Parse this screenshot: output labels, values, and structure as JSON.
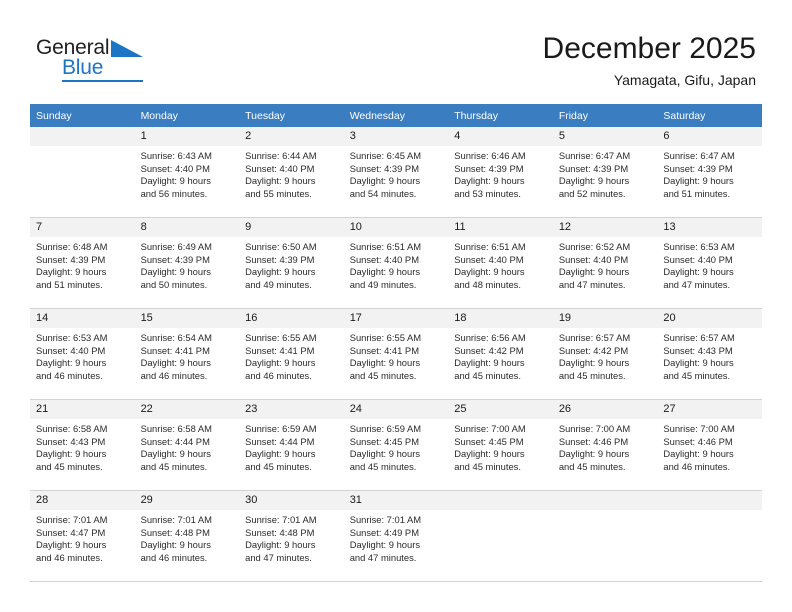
{
  "brand": {
    "name_part1": "General",
    "name_part2": "Blue",
    "triangle_icon": "triangle-icon",
    "accent_color": "#1c76c5"
  },
  "header": {
    "title": "December 2025",
    "subtitle": "Yamagata, Gifu, Japan"
  },
  "calendar": {
    "header_bg_color": "#3a7dc0",
    "daynum_bg_color": "#f2f2f2",
    "weekdays": [
      "Sunday",
      "Monday",
      "Tuesday",
      "Wednesday",
      "Thursday",
      "Friday",
      "Saturday"
    ],
    "weeks": [
      [
        {
          "day": "",
          "lines": []
        },
        {
          "day": "1",
          "lines": [
            "Sunrise: 6:43 AM",
            "Sunset: 4:40 PM",
            "Daylight: 9 hours",
            "and 56 minutes."
          ]
        },
        {
          "day": "2",
          "lines": [
            "Sunrise: 6:44 AM",
            "Sunset: 4:40 PM",
            "Daylight: 9 hours",
            "and 55 minutes."
          ]
        },
        {
          "day": "3",
          "lines": [
            "Sunrise: 6:45 AM",
            "Sunset: 4:39 PM",
            "Daylight: 9 hours",
            "and 54 minutes."
          ]
        },
        {
          "day": "4",
          "lines": [
            "Sunrise: 6:46 AM",
            "Sunset: 4:39 PM",
            "Daylight: 9 hours",
            "and 53 minutes."
          ]
        },
        {
          "day": "5",
          "lines": [
            "Sunrise: 6:47 AM",
            "Sunset: 4:39 PM",
            "Daylight: 9 hours",
            "and 52 minutes."
          ]
        },
        {
          "day": "6",
          "lines": [
            "Sunrise: 6:47 AM",
            "Sunset: 4:39 PM",
            "Daylight: 9 hours",
            "and 51 minutes."
          ]
        }
      ],
      [
        {
          "day": "7",
          "lines": [
            "Sunrise: 6:48 AM",
            "Sunset: 4:39 PM",
            "Daylight: 9 hours",
            "and 51 minutes."
          ]
        },
        {
          "day": "8",
          "lines": [
            "Sunrise: 6:49 AM",
            "Sunset: 4:39 PM",
            "Daylight: 9 hours",
            "and 50 minutes."
          ]
        },
        {
          "day": "9",
          "lines": [
            "Sunrise: 6:50 AM",
            "Sunset: 4:39 PM",
            "Daylight: 9 hours",
            "and 49 minutes."
          ]
        },
        {
          "day": "10",
          "lines": [
            "Sunrise: 6:51 AM",
            "Sunset: 4:40 PM",
            "Daylight: 9 hours",
            "and 49 minutes."
          ]
        },
        {
          "day": "11",
          "lines": [
            "Sunrise: 6:51 AM",
            "Sunset: 4:40 PM",
            "Daylight: 9 hours",
            "and 48 minutes."
          ]
        },
        {
          "day": "12",
          "lines": [
            "Sunrise: 6:52 AM",
            "Sunset: 4:40 PM",
            "Daylight: 9 hours",
            "and 47 minutes."
          ]
        },
        {
          "day": "13",
          "lines": [
            "Sunrise: 6:53 AM",
            "Sunset: 4:40 PM",
            "Daylight: 9 hours",
            "and 47 minutes."
          ]
        }
      ],
      [
        {
          "day": "14",
          "lines": [
            "Sunrise: 6:53 AM",
            "Sunset: 4:40 PM",
            "Daylight: 9 hours",
            "and 46 minutes."
          ]
        },
        {
          "day": "15",
          "lines": [
            "Sunrise: 6:54 AM",
            "Sunset: 4:41 PM",
            "Daylight: 9 hours",
            "and 46 minutes."
          ]
        },
        {
          "day": "16",
          "lines": [
            "Sunrise: 6:55 AM",
            "Sunset: 4:41 PM",
            "Daylight: 9 hours",
            "and 46 minutes."
          ]
        },
        {
          "day": "17",
          "lines": [
            "Sunrise: 6:55 AM",
            "Sunset: 4:41 PM",
            "Daylight: 9 hours",
            "and 45 minutes."
          ]
        },
        {
          "day": "18",
          "lines": [
            "Sunrise: 6:56 AM",
            "Sunset: 4:42 PM",
            "Daylight: 9 hours",
            "and 45 minutes."
          ]
        },
        {
          "day": "19",
          "lines": [
            "Sunrise: 6:57 AM",
            "Sunset: 4:42 PM",
            "Daylight: 9 hours",
            "and 45 minutes."
          ]
        },
        {
          "day": "20",
          "lines": [
            "Sunrise: 6:57 AM",
            "Sunset: 4:43 PM",
            "Daylight: 9 hours",
            "and 45 minutes."
          ]
        }
      ],
      [
        {
          "day": "21",
          "lines": [
            "Sunrise: 6:58 AM",
            "Sunset: 4:43 PM",
            "Daylight: 9 hours",
            "and 45 minutes."
          ]
        },
        {
          "day": "22",
          "lines": [
            "Sunrise: 6:58 AM",
            "Sunset: 4:44 PM",
            "Daylight: 9 hours",
            "and 45 minutes."
          ]
        },
        {
          "day": "23",
          "lines": [
            "Sunrise: 6:59 AM",
            "Sunset: 4:44 PM",
            "Daylight: 9 hours",
            "and 45 minutes."
          ]
        },
        {
          "day": "24",
          "lines": [
            "Sunrise: 6:59 AM",
            "Sunset: 4:45 PM",
            "Daylight: 9 hours",
            "and 45 minutes."
          ]
        },
        {
          "day": "25",
          "lines": [
            "Sunrise: 7:00 AM",
            "Sunset: 4:45 PM",
            "Daylight: 9 hours",
            "and 45 minutes."
          ]
        },
        {
          "day": "26",
          "lines": [
            "Sunrise: 7:00 AM",
            "Sunset: 4:46 PM",
            "Daylight: 9 hours",
            "and 45 minutes."
          ]
        },
        {
          "day": "27",
          "lines": [
            "Sunrise: 7:00 AM",
            "Sunset: 4:46 PM",
            "Daylight: 9 hours",
            "and 46 minutes."
          ]
        }
      ],
      [
        {
          "day": "28",
          "lines": [
            "Sunrise: 7:01 AM",
            "Sunset: 4:47 PM",
            "Daylight: 9 hours",
            "and 46 minutes."
          ]
        },
        {
          "day": "29",
          "lines": [
            "Sunrise: 7:01 AM",
            "Sunset: 4:48 PM",
            "Daylight: 9 hours",
            "and 46 minutes."
          ]
        },
        {
          "day": "30",
          "lines": [
            "Sunrise: 7:01 AM",
            "Sunset: 4:48 PM",
            "Daylight: 9 hours",
            "and 47 minutes."
          ]
        },
        {
          "day": "31",
          "lines": [
            "Sunrise: 7:01 AM",
            "Sunset: 4:49 PM",
            "Daylight: 9 hours",
            "and 47 minutes."
          ]
        },
        {
          "day": "",
          "lines": []
        },
        {
          "day": "",
          "lines": []
        },
        {
          "day": "",
          "lines": []
        }
      ]
    ]
  }
}
